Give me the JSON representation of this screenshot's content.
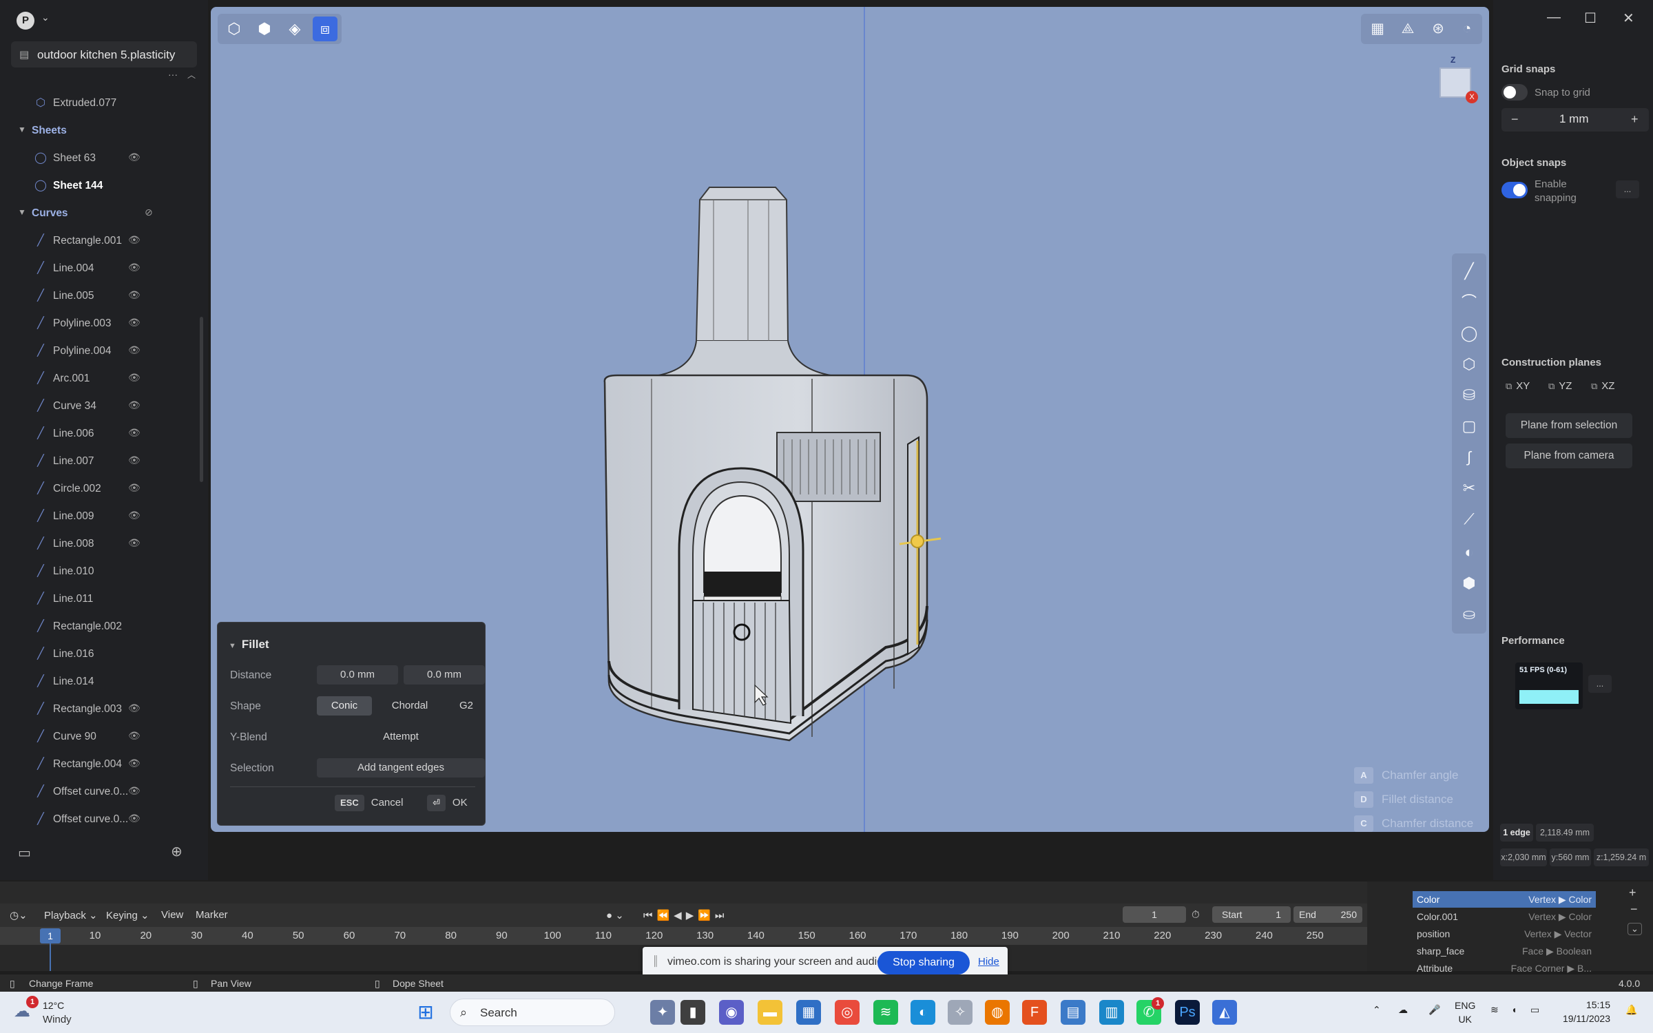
{
  "outliner": {
    "account_initial": "P",
    "file_name": "outdoor kitchen 5.plasticity",
    "items": [
      {
        "label": "Extruded.077",
        "kind": "solid"
      },
      {
        "label": "Sheets",
        "kind": "section"
      },
      {
        "label": "Sheet 63",
        "kind": "sheet"
      },
      {
        "label": "Sheet 144",
        "kind": "sheet-selected"
      },
      {
        "label": "Curves",
        "kind": "section"
      },
      {
        "label": "Rectangle.001",
        "kind": "curve"
      },
      {
        "label": "Line.004",
        "kind": "curve"
      },
      {
        "label": "Line.005",
        "kind": "curve"
      },
      {
        "label": "Polyline.003",
        "kind": "curve"
      },
      {
        "label": "Polyline.004",
        "kind": "curve"
      },
      {
        "label": "Arc.001",
        "kind": "curve"
      },
      {
        "label": "Curve 34",
        "kind": "curve"
      },
      {
        "label": "Line.006",
        "kind": "curve"
      },
      {
        "label": "Line.007",
        "kind": "curve"
      },
      {
        "label": "Circle.002",
        "kind": "curve"
      },
      {
        "label": "Line.009",
        "kind": "curve"
      },
      {
        "label": "Line.008",
        "kind": "curve"
      },
      {
        "label": "Line.010",
        "kind": "curve"
      },
      {
        "label": "Line.011",
        "kind": "curve"
      },
      {
        "label": "Rectangle.002",
        "kind": "curve"
      },
      {
        "label": "Line.016",
        "kind": "curve"
      },
      {
        "label": "Line.014",
        "kind": "curve"
      },
      {
        "label": "Rectangle.003",
        "kind": "curve"
      },
      {
        "label": "Curve 90",
        "kind": "curve"
      },
      {
        "label": "Rectangle.004",
        "kind": "curve"
      },
      {
        "label": "Offset curve.0...",
        "kind": "curve"
      },
      {
        "label": "Offset curve.0...",
        "kind": "curve"
      }
    ]
  },
  "fillet": {
    "title": "Fillet",
    "distance_label": "Distance",
    "distance_1": "0.0 mm",
    "distance_2": "0.0 mm",
    "shape_label": "Shape",
    "shape_options": [
      "Conic",
      "Chordal",
      "G2"
    ],
    "yblend_label": "Y-Blend",
    "yblend_value": "Attempt",
    "selection_label": "Selection",
    "selection_value": "Add tangent edges",
    "esc_key": "ESC",
    "cancel": "Cancel",
    "ok_key": "⏎",
    "ok": "OK"
  },
  "hints": [
    {
      "key": "A",
      "label": "Chamfer angle"
    },
    {
      "key": "D",
      "label": "Fillet distance"
    },
    {
      "key": "C",
      "label": "Chamfer distance"
    }
  ],
  "navcube": {
    "z_label": "Z",
    "x_label": "X"
  },
  "right_panel": {
    "grid_snaps": "Grid snaps",
    "snap_to_grid": "Snap to grid",
    "grid_size": "1 mm",
    "object_snaps": "Object snaps",
    "enable_snapping": "Enable snapping",
    "construction_planes": "Construction planes",
    "planes": [
      "XY",
      "YZ",
      "XZ"
    ],
    "plane_from_selection": "Plane from selection",
    "plane_from_camera": "Plane from camera",
    "performance": "Performance",
    "fps": "51 FPS (0-61)",
    "more": "...",
    "edge_count": "1 edge",
    "length": "2,118.49 mm",
    "x": "x:2,030 mm",
    "y": "y:560 mm",
    "z": "z:1,259.24 m"
  },
  "timeline": {
    "menus": [
      "Playback",
      "Keying",
      "View",
      "Marker"
    ],
    "current_frame": "1",
    "frame_field": "1",
    "start_label": "Start",
    "start": "1",
    "end_label": "End",
    "end": "250",
    "ticks": [
      "10",
      "20",
      "30",
      "40",
      "50",
      "60",
      "70",
      "80",
      "90",
      "100",
      "110",
      "120",
      "130",
      "140",
      "150",
      "160",
      "170",
      "180",
      "190",
      "200",
      "210",
      "220",
      "230",
      "240",
      "250"
    ]
  },
  "attributes": [
    {
      "name": "Color",
      "type": "Vertex ▶ Color"
    },
    {
      "name": "Color.001",
      "type": "Vertex ▶ Color"
    },
    {
      "name": "position",
      "type": "Vertex ▶ Vector"
    },
    {
      "name": "sharp_face",
      "type": "Face ▶ Boolean"
    },
    {
      "name": "Attribute",
      "type": "Face Corner ▶ B..."
    }
  ],
  "share_bar": {
    "text": "vimeo.com is sharing your screen and audio.",
    "stop": "Stop sharing",
    "hide": "Hide"
  },
  "status": {
    "change_frame": "Change Frame",
    "pan_view": "Pan View",
    "dope_sheet": "Dope Sheet",
    "version": "4.0.0"
  },
  "taskbar": {
    "temp": "12°C",
    "weather": "Windy",
    "weather_badge": "1",
    "search": "Search",
    "whatsapp_badge": "1",
    "lang1": "ENG",
    "lang2": "UK",
    "time": "15:15",
    "date": "19/11/2023"
  },
  "colors": {
    "accent": "#3c6be0",
    "viewport": "#8ba0c6",
    "blender_select": "#4772b3"
  }
}
